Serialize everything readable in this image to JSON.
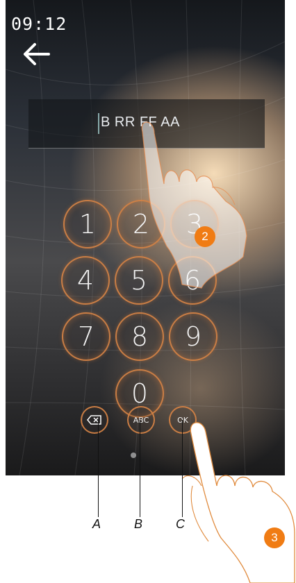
{
  "status": {
    "time": "09:12"
  },
  "password_field": {
    "value": "B RR FF AA"
  },
  "keypad": {
    "keys": [
      "1",
      "2",
      "3",
      "4",
      "5",
      "6",
      "7",
      "8",
      "9",
      "0"
    ],
    "delete_icon": "backspace-icon",
    "abc_label": "ABC",
    "ok_label": "OK"
  },
  "callouts": {
    "a": "A",
    "b": "B",
    "c": "C"
  },
  "steps": {
    "step2": "2",
    "step3": "3"
  },
  "colors": {
    "accent": "#f07c14",
    "ring": "#d2823c"
  }
}
